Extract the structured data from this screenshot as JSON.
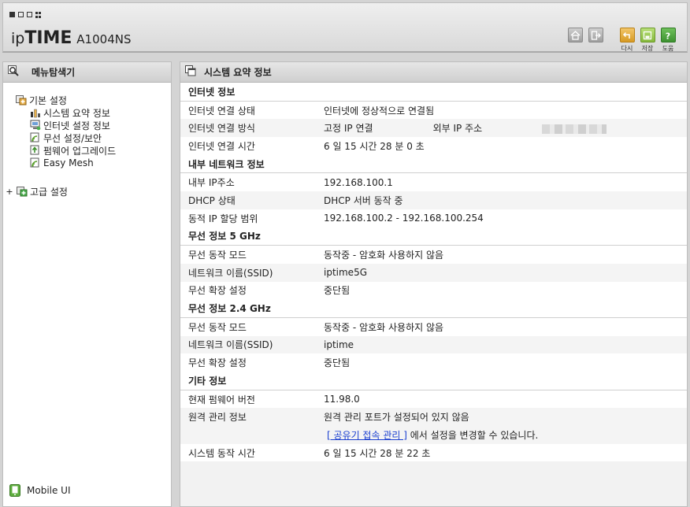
{
  "header": {
    "brand_ip": "ip",
    "brand_time": "TIME",
    "model": "A1004NS",
    "buttons": [
      {
        "id": "home",
        "icon": "home-icon"
      },
      {
        "id": "logout",
        "icon": "logout-icon"
      },
      {
        "id": "back",
        "label": "다시",
        "icon": "back-icon",
        "color": "#d79a23"
      },
      {
        "id": "save",
        "label": "저장",
        "icon": "save-icon",
        "color": "#85b83c"
      },
      {
        "id": "help",
        "label": "도움",
        "icon": "help-icon",
        "color": "#3d9230"
      }
    ]
  },
  "left": {
    "title": "메뉴탐색기",
    "basic": {
      "label": "기본 설정",
      "items": [
        "시스템 요약 정보",
        "인터넷 설정 정보",
        "무선 설정/보안",
        "펌웨어 업그레이드",
        "Easy Mesh"
      ]
    },
    "advanced": {
      "expander": "+",
      "label": "고급 설정"
    },
    "mobile": "Mobile UI"
  },
  "right": {
    "title": "시스템 요약 정보",
    "internet": {
      "title": "인터넷 정보",
      "status_k": "인터넷 연결 상태",
      "status_v": "인터넷에 정상적으로 연결됨",
      "method_k": "인터넷 연결 방식",
      "method_v": "고정 IP 연결",
      "ext_ip_label": "외부 IP 주소",
      "time_k": "인터넷 연결 시간",
      "time_v": "6 일 15 시간 28 분 0 초"
    },
    "lan": {
      "title": "내부 네트워크 정보",
      "ip_k": "내부 IP주소",
      "ip_v": "192.168.100.1",
      "dhcp_k": "DHCP 상태",
      "dhcp_v": "DHCP 서버 동작 중",
      "range_k": "동적 IP 할당 범위",
      "range_v": "192.168.100.2 -  192.168.100.254"
    },
    "w5": {
      "title": "무선 정보 5 GHz",
      "mode_k": "무선 동작 모드",
      "mode_v": "동작중 - 암호화 사용하지 않음",
      "ssid_k": "네트워크 이름(SSID)",
      "ssid_v": "iptime5G",
      "ext_k": "무선 확장 설정",
      "ext_v": "중단됨"
    },
    "w24": {
      "title": "무선 정보 2.4 GHz",
      "mode_k": "무선 동작 모드",
      "mode_v": "동작중 - 암호화 사용하지 않음",
      "ssid_k": "네트워크 이름(SSID)",
      "ssid_v": "iptime",
      "ext_k": "무선 확장 설정",
      "ext_v": "중단됨"
    },
    "etc": {
      "title": "기타 정보",
      "fw_k": "현재 펌웨어 버전",
      "fw_v": "11.98.0",
      "remote_k": "원격 관리 정보",
      "remote_v": "원격 관리 포트가 설정되어 있지 않음",
      "remote_link": "[ 공유기 접속 관리 ]",
      "remote_suffix": " 에서 설정을 변경할 수 있습니다.",
      "uptime_k": "시스템 동작 시간",
      "uptime_v": "6 일 15 시간 28 분 22 초"
    }
  }
}
